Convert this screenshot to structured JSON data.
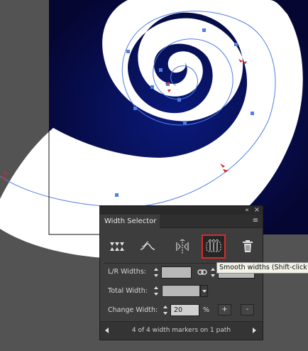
{
  "panel": {
    "title": "Width Selector",
    "collapse_icon": "double-chevron-icon",
    "close_icon": "close-icon",
    "menu_icon": "panel-menu-icon",
    "tools": [
      {
        "name": "width-points-tool",
        "icon": "width-points-icon"
      },
      {
        "name": "smooth-curve-tool",
        "icon": "wave-icon"
      },
      {
        "name": "mirror-widths-tool",
        "icon": "mirror-widths-icon"
      },
      {
        "name": "smooth-widths-tool",
        "icon": "smooth-widths-icon",
        "selected": true
      },
      {
        "name": "delete-marker-tool",
        "icon": "trash-icon"
      }
    ],
    "lr_widths_label": "L/R Widths:",
    "total_width_label": "Total Width:",
    "change_width_label": "Change Width:",
    "change_width_value": "20",
    "percent": "%",
    "plus": "+",
    "minus": "-",
    "status": "4 of 4 width markers on 1 path",
    "link_icon": "chain-link-icon"
  },
  "tooltip": {
    "text": "Smooth widths (Shift-click"
  },
  "colors": {
    "canvas_bg": "#535353",
    "artboard": "#0b0c52",
    "shape": "#ffffff",
    "path": "#4f7fe0",
    "marker": "#d62b2b",
    "selected_outline": "#d62b2b"
  }
}
